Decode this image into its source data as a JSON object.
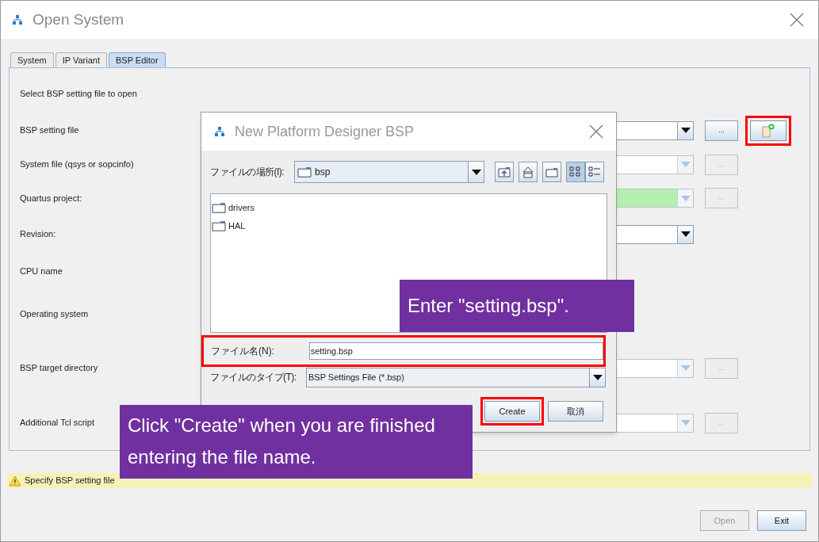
{
  "window": {
    "title": "Open System"
  },
  "tabs": [
    {
      "label": "System",
      "selected": false
    },
    {
      "label": "IP Variant",
      "selected": false
    },
    {
      "label": "BSP Editor",
      "selected": true
    }
  ],
  "instruction": "Select BSP setting file to open",
  "fields": [
    {
      "label": "BSP setting file",
      "kind": "combo",
      "disabled": false,
      "valid": false,
      "browse": {
        "label": "...",
        "disabled": false
      },
      "new_button": {
        "highlighted": true
      }
    },
    {
      "label": "System file (qsys or sopcinfo)",
      "kind": "combo",
      "disabled": true,
      "valid": false,
      "browse": {
        "label": "...",
        "disabled": true
      }
    },
    {
      "label": "Quartus project:",
      "kind": "combo",
      "disabled": true,
      "valid": true,
      "browse": {
        "label": "...",
        "disabled": true
      }
    },
    {
      "label": "Revision:",
      "kind": "combo",
      "disabled": false,
      "valid": false
    },
    {
      "label": "CPU name",
      "kind": "label"
    },
    {
      "label": "Operating system",
      "kind": "label"
    },
    {
      "label": "BSP target directory",
      "kind": "combo",
      "disabled": true,
      "valid": false,
      "browse": {
        "label": "...",
        "disabled": true
      }
    },
    {
      "label": "Additional Tcl script",
      "kind": "combo",
      "disabled": true,
      "valid": false,
      "browse": {
        "label": "...",
        "disabled": true
      }
    }
  ],
  "status": {
    "kind": "warning",
    "text": "Specify BSP setting file"
  },
  "buttons": [
    {
      "label": "Open",
      "disabled": true
    },
    {
      "label": "Exit",
      "disabled": false
    }
  ],
  "dialog": {
    "title": "New Platform Designer BSP",
    "look_in": {
      "label": "ファイルの場所(I):",
      "value": "bsp"
    },
    "toolbar": [
      {
        "kind": "up",
        "selected": false
      },
      {
        "kind": "home",
        "selected": false
      },
      {
        "kind": "new-folder",
        "selected": false
      },
      {
        "kind": "list",
        "selected": true
      },
      {
        "kind": "details",
        "selected": false
      }
    ],
    "files": [
      {
        "name": "drivers"
      },
      {
        "name": "HAL"
      }
    ],
    "file_name": {
      "label": "ファイル名(N):",
      "value": "setting.bsp",
      "highlighted": true
    },
    "file_type": {
      "label": "ファイルのタイプ(T):",
      "value": "BSP Settings File (*.bsp)"
    },
    "buttons": [
      {
        "label": "Create",
        "highlighted": true
      },
      {
        "label": "取消",
        "highlighted": false
      }
    ]
  },
  "callouts": [
    {
      "text": "Enter \"setting.bsp\"."
    },
    {
      "text": "Click \"Create\" when you are finished entering the file name."
    }
  ]
}
